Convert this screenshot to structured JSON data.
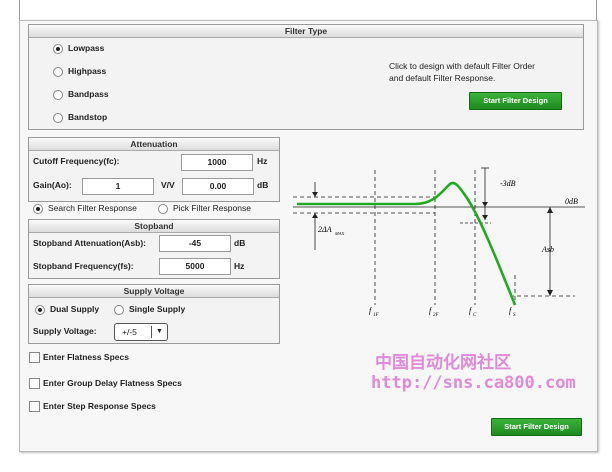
{
  "filter_type": {
    "title": "Filter Type",
    "options": [
      "Lowpass",
      "Highpass",
      "Bandpass",
      "Bandstop"
    ],
    "selected": "Lowpass",
    "hint_line1": "Click to design with default Filter Order",
    "hint_line2": "and default Filter Response.",
    "start_button": "Start Filter Design"
  },
  "attenuation": {
    "title": "Attenuation",
    "cutoff_label": "Cutoff Frequency(fc):",
    "cutoff_value": "1000",
    "cutoff_unit": "Hz",
    "gain_label": "Gain(Ao):",
    "gain_value": "1",
    "gain_unit": "V/V",
    "gain_db_value": "0.00",
    "gain_db_unit": "dB"
  },
  "search_mode": {
    "search_label": "Search Filter Response",
    "pick_label": "Pick Filter Response",
    "selected": "search"
  },
  "stopband": {
    "title": "Stopband",
    "atten_label": "Stopband Attenuation(Asb):",
    "atten_value": "-45",
    "atten_unit": "dB",
    "freq_label": "Stopband Frequency(fs):",
    "freq_value": "5000",
    "freq_unit": "Hz"
  },
  "supply": {
    "title": "Supply Voltage",
    "dual_label": "Dual Supply",
    "single_label": "Single Supply",
    "selected": "dual",
    "voltage_label": "Supply Voltage:",
    "voltage_value": "+/-5"
  },
  "checks": {
    "flatness": "Enter Flatness Specs",
    "group_delay": "Enter Group Delay Flatness Specs",
    "step": "Enter Step Response Specs"
  },
  "diagram": {
    "label_3db": "-3dB",
    "label_0db": "0dB",
    "label_2da": "2ΔA",
    "label_2da_sub": "MAX",
    "label_asb": "Asb",
    "f_labels": [
      "f",
      "f",
      "f",
      "f"
    ],
    "f_subs": [
      "1F",
      "2F",
      "C",
      "S"
    ]
  },
  "watermark": {
    "line1": "中国自动化网社区",
    "line2": "http://sns.ca800.com"
  },
  "footer_button": "Start Filter Design",
  "colors": {
    "accent": "#2a9d2a",
    "curve": "#22aa22",
    "watermark": "#e08ad8"
  }
}
